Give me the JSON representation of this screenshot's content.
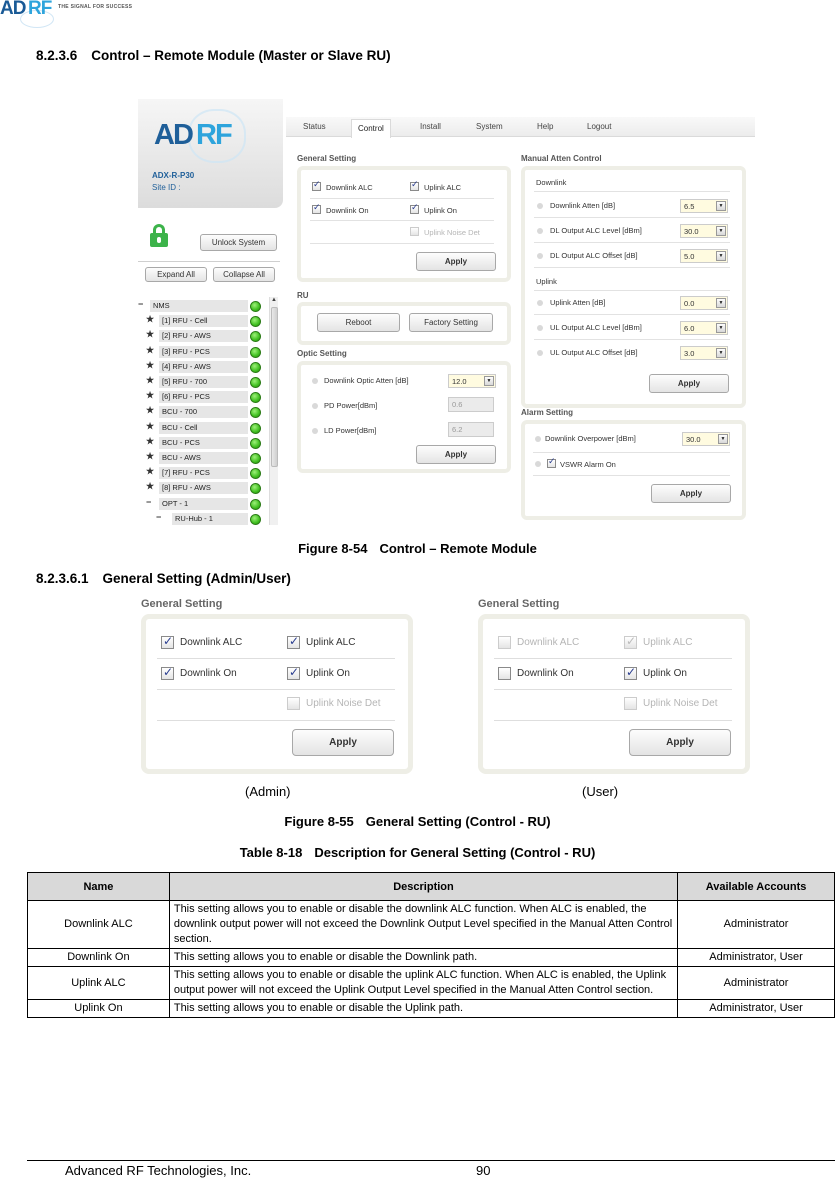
{
  "header": {
    "logo_text_a": "AD",
    "logo_text_b": "RF",
    "tagline": "THE SIGNAL FOR SUCCESS"
  },
  "section": {
    "number": "8.2.3.6",
    "title": "Control – Remote Module (Master or Slave RU)"
  },
  "ui": {
    "logo_a": "AD",
    "logo_b": "RF",
    "model": "ADX-R-P30",
    "site_id_label": "Site ID :",
    "unlock_button": "Unlock System",
    "expand_all": "Expand All",
    "collapse_all": "Collapse All",
    "nav_tabs": [
      {
        "label": "Status",
        "active": false
      },
      {
        "label": "Control",
        "active": true
      },
      {
        "label": "Install",
        "active": false
      },
      {
        "label": "System",
        "active": false
      },
      {
        "label": "Help",
        "active": false
      },
      {
        "label": "Logout",
        "active": false
      }
    ],
    "tree": [
      {
        "mark": "−",
        "label": "NMS",
        "level": 0
      },
      {
        "mark": "★",
        "label": "[1] RFU - Cell",
        "level": 1
      },
      {
        "mark": "★",
        "label": "[2] RFU - AWS",
        "level": 1
      },
      {
        "mark": "★",
        "label": "[3] RFU - PCS",
        "level": 1
      },
      {
        "mark": "★",
        "label": "[4] RFU - AWS",
        "level": 1
      },
      {
        "mark": "★",
        "label": "[5] RFU - 700",
        "level": 1
      },
      {
        "mark": "★",
        "label": "[6] RFU - PCS",
        "level": 1
      },
      {
        "mark": "★",
        "label": "BCU - 700",
        "level": 1
      },
      {
        "mark": "★",
        "label": "BCU - Cell",
        "level": 1
      },
      {
        "mark": "★",
        "label": "BCU - PCS",
        "level": 1
      },
      {
        "mark": "★",
        "label": "BCU - AWS",
        "level": 1
      },
      {
        "mark": "★",
        "label": "[7] RFU - PCS",
        "level": 1
      },
      {
        "mark": "★",
        "label": "[8] RFU - AWS",
        "level": 1
      },
      {
        "mark": "−",
        "label": "OPT - 1",
        "level": 1
      },
      {
        "mark": "−",
        "label": "RU-Hub - 1",
        "level": 2
      }
    ],
    "general_setting": {
      "title": "General Setting",
      "downlink_alc": {
        "label": "Downlink ALC",
        "checked": true
      },
      "uplink_alc": {
        "label": "Uplink ALC",
        "checked": true
      },
      "downlink_on": {
        "label": "Downlink On",
        "checked": true
      },
      "uplink_on": {
        "label": "Uplink On",
        "checked": true
      },
      "uplink_noise_det": {
        "label": "Uplink Noise Det",
        "checked": false,
        "disabled": true
      },
      "apply": "Apply"
    },
    "ru": {
      "title": "RU",
      "reboot": "Reboot",
      "factory": "Factory Setting"
    },
    "optic": {
      "title": "Optic Setting",
      "dl_optic_atten_label": "Downlink Optic Atten [dB]",
      "dl_optic_atten_value": "12.0",
      "pd_power_label": "PD Power[dBm]",
      "pd_power_value": "0.6",
      "ld_power_label": "LD Power[dBm]",
      "ld_power_value": "6.2",
      "apply": "Apply"
    },
    "manual_atten": {
      "title": "Manual Atten Control",
      "downlink_title": "Downlink",
      "downlink": [
        {
          "label": "Downlink Atten [dB]",
          "value": "6.5"
        },
        {
          "label": "DL Output ALC Level [dBm]",
          "value": "30.0"
        },
        {
          "label": "DL Output ALC Offset [dB]",
          "value": "5.0"
        }
      ],
      "uplink_title": "Uplink",
      "uplink": [
        {
          "label": "Uplink Atten [dB]",
          "value": "0.0"
        },
        {
          "label": "UL Output ALC Level [dBm]",
          "value": "6.0"
        },
        {
          "label": "UL Output ALC Offset [dB]",
          "value": "3.0"
        }
      ],
      "apply": "Apply"
    },
    "alarm": {
      "title": "Alarm Setting",
      "dl_overpower_label": "Downlink Overpower [dBm]",
      "dl_overpower_value": "30.0",
      "vswr_label": "VSWR Alarm On",
      "vswr_checked": true,
      "apply": "Apply"
    }
  },
  "figure1_caption": {
    "number": "Figure 8-54",
    "title": "Control – Remote Module"
  },
  "subsection": {
    "number": "8.2.3.6.1",
    "title": "General Setting (Admin/User)"
  },
  "admin_panel": {
    "title": "General Setting",
    "caption": "(Admin)",
    "downlink_alc": {
      "label": "Downlink ALC",
      "checked": true,
      "disabled": false
    },
    "uplink_alc": {
      "label": "Uplink ALC",
      "checked": true,
      "disabled": false
    },
    "downlink_on": {
      "label": "Downlink On",
      "checked": true,
      "disabled": false
    },
    "uplink_on": {
      "label": "Uplink On",
      "checked": true,
      "disabled": false
    },
    "uplink_noise_det": {
      "label": "Uplink Noise Det",
      "checked": false,
      "disabled": true
    },
    "apply": "Apply"
  },
  "user_panel": {
    "title": "General Setting",
    "caption": "(User)",
    "downlink_alc": {
      "label": "Downlink ALC",
      "checked": false,
      "disabled": true
    },
    "uplink_alc": {
      "label": "Uplink ALC",
      "checked": true,
      "disabled": true
    },
    "downlink_on": {
      "label": "Downlink On",
      "checked": false,
      "disabled": false
    },
    "uplink_on": {
      "label": "Uplink On",
      "checked": true,
      "disabled": false
    },
    "uplink_noise_det": {
      "label": "Uplink Noise Det",
      "checked": false,
      "disabled": true
    },
    "apply": "Apply"
  },
  "figure2_caption": {
    "number": "Figure 8-55",
    "title": "General Setting (Control - RU)"
  },
  "table_caption": {
    "number": "Table 8-18",
    "title": "Description for General Setting (Control - RU)"
  },
  "table": {
    "headers": [
      "Name",
      "Description",
      "Available Accounts"
    ],
    "rows": [
      {
        "name": "Downlink ALC",
        "description": "This setting allows you to enable or disable the downlink ALC function. When ALC is enabled, the downlink output power will not exceed the Downlink Output Level specified in the Manual Atten Control section.",
        "accounts": "Administrator"
      },
      {
        "name": "Downlink On",
        "description": "This setting allows you to enable or disable the Downlink path.",
        "accounts": "Administrator, User"
      },
      {
        "name": "Uplink ALC",
        "description": "This setting allows you to enable or disable the uplink ALC function. When ALC is enabled, the Uplink output power will not exceed the Uplink Output Level specified in the Manual Atten Control section.",
        "accounts": "Administrator"
      },
      {
        "name": "Uplink On",
        "description": "This setting allows you to enable or disable the Uplink path.",
        "accounts": "Administrator, User"
      }
    ]
  },
  "footer": {
    "company": "Advanced RF Technologies, Inc.",
    "page": "90"
  }
}
